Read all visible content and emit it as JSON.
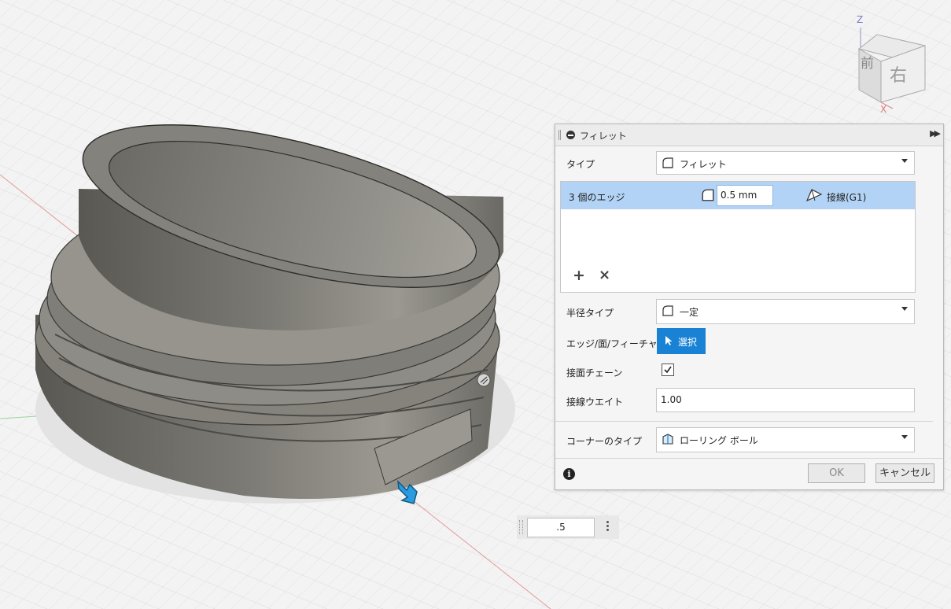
{
  "viewcube": {
    "front": "前",
    "right": "右",
    "z_axis": "Z",
    "x_axis": "X"
  },
  "dialog": {
    "title": "フィレット",
    "type_label": "タイプ",
    "type_value": "フィレット",
    "edges_row": {
      "label": "3 個のエッジ",
      "radius": "0.5 mm",
      "continuity": "接線(G1)"
    },
    "add_symbol": "+",
    "remove_symbol": "×",
    "radius_type_label": "半径タイプ",
    "radius_type_value": "一定",
    "edge_face_label": "エッジ/面/フィーチャ",
    "select_label": "選択",
    "tangent_chain_label": "接面チェーン",
    "tangent_chain_checked": true,
    "tangent_weight_label": "接線ウエイト",
    "tangent_weight_value": "1.00",
    "corner_type_label": "コーナーのタイプ",
    "corner_type_value": "ローリング ボール",
    "ok_label": "OK",
    "cancel_label": "キャンセル",
    "info_symbol": "i"
  },
  "mini_toolbar": {
    "value": ".5"
  },
  "colors": {
    "accent": "#1a82d4",
    "selection": "#b2d3f5",
    "model": "#6e6b66"
  }
}
